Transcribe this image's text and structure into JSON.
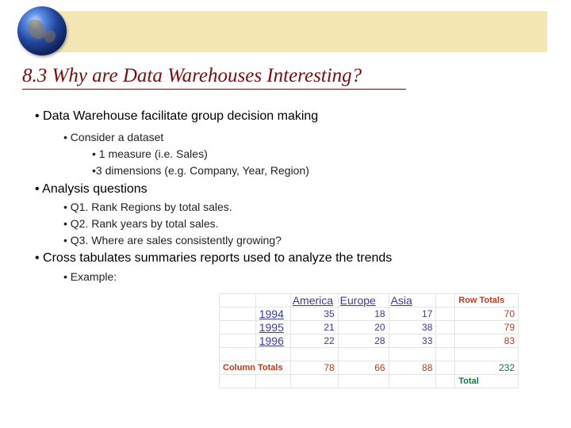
{
  "slide": {
    "title": "8.3 Why are Data Warehouses Interesting?",
    "bullets": [
      "• Data Warehouse facilitate group decision making",
      "• Consider a dataset",
      "• 1 measure (i.e. Sales)",
      "•3 dimensions (e.g. Company, Year, Region)",
      "•  Analysis questions",
      "• Q1. Rank Regions by total sales.",
      "• Q2. Rank years by total sales.",
      "• Q3. Where are sales consistently growing?",
      "• Cross tabulates summaries reports used to analyze the trends",
      "• Example:"
    ]
  },
  "crosstab": {
    "columns": [
      "America",
      "Europe",
      "Asia"
    ],
    "row_totals_label": "Row Totals",
    "column_totals_label": "Column Totals",
    "total_label": "Total",
    "rows": [
      {
        "year": "1994",
        "values": [
          "35",
          "18",
          "17"
        ],
        "total": "70"
      },
      {
        "year": "1995",
        "values": [
          "21",
          "20",
          "38"
        ],
        "total": "79"
      },
      {
        "year": "1996",
        "values": [
          "22",
          "28",
          "33"
        ],
        "total": "83"
      }
    ],
    "column_totals": [
      "78",
      "66",
      "88"
    ],
    "grand_total": "232"
  },
  "colors": {
    "title": "#7a0e0e",
    "band": "#f5e7b4",
    "link_blue": "#3a3a9a",
    "total_red": "#c0391b",
    "total_green": "#0e7a3a"
  }
}
